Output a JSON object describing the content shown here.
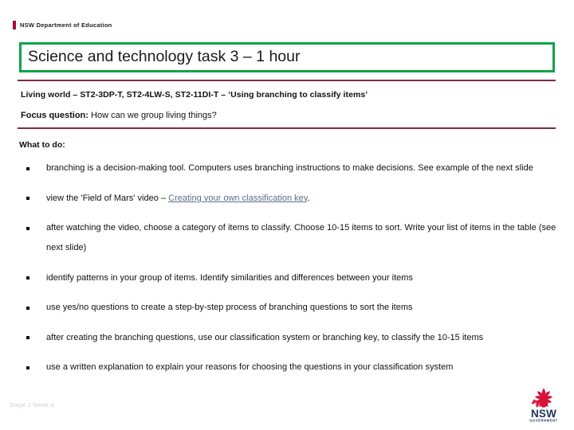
{
  "brand": {
    "department": "NSW Department of Education",
    "accent_bar_color": "#A6093D"
  },
  "title": {
    "text": "Science and technology task 3 – 1 hour",
    "border_color": "#10A34A"
  },
  "rules": {
    "color": "#7C2B4B"
  },
  "outcomes": {
    "line": "Living world – ST2-3DP-T, ST2-4LW-S, ST2-11DI-T – ‘Using branching to classify items’"
  },
  "focus": {
    "label": "Focus question:",
    "question": "How can we group living things?"
  },
  "what_to_do": {
    "heading": "What to do:",
    "bullets": [
      {
        "pre": "branching is a decision-making tool. Computers uses branching instructions to make decisions. See example of the next slide",
        "link": "",
        "post": ""
      },
      {
        "pre": "view the 'Field of Mars' video – ",
        "link": "Creating your own classification key",
        "post": "."
      },
      {
        "pre": "after watching the video, choose a category of items to classify. Choose 10-15 items to sort. Write your list of items in the table (see next slide)",
        "link": "",
        "post": ""
      },
      {
        "pre": "identify patterns in your group of items. Identify similarities and differences between your items",
        "link": "",
        "post": ""
      },
      {
        "pre": "use yes/no questions to create a step-by-step process of branching questions to sort the items",
        "link": "",
        "post": ""
      },
      {
        "pre": "after creating the branching questions, use our classification system or branching key, to classify the 10-15 items",
        "link": "",
        "post": ""
      },
      {
        "pre": "use a written explanation to explain your reasons for choosing the questions in your classification system",
        "link": "",
        "post": ""
      }
    ],
    "link_color": "#5B6E8C"
  },
  "footer": {
    "note": "Stage 2 Week A",
    "logo": {
      "name": "nsw-government-logo",
      "wordmark": "NSW",
      "subtext": "GOVERNMENT",
      "flower_color": "#D7153A",
      "text_color": "#22355B"
    }
  }
}
